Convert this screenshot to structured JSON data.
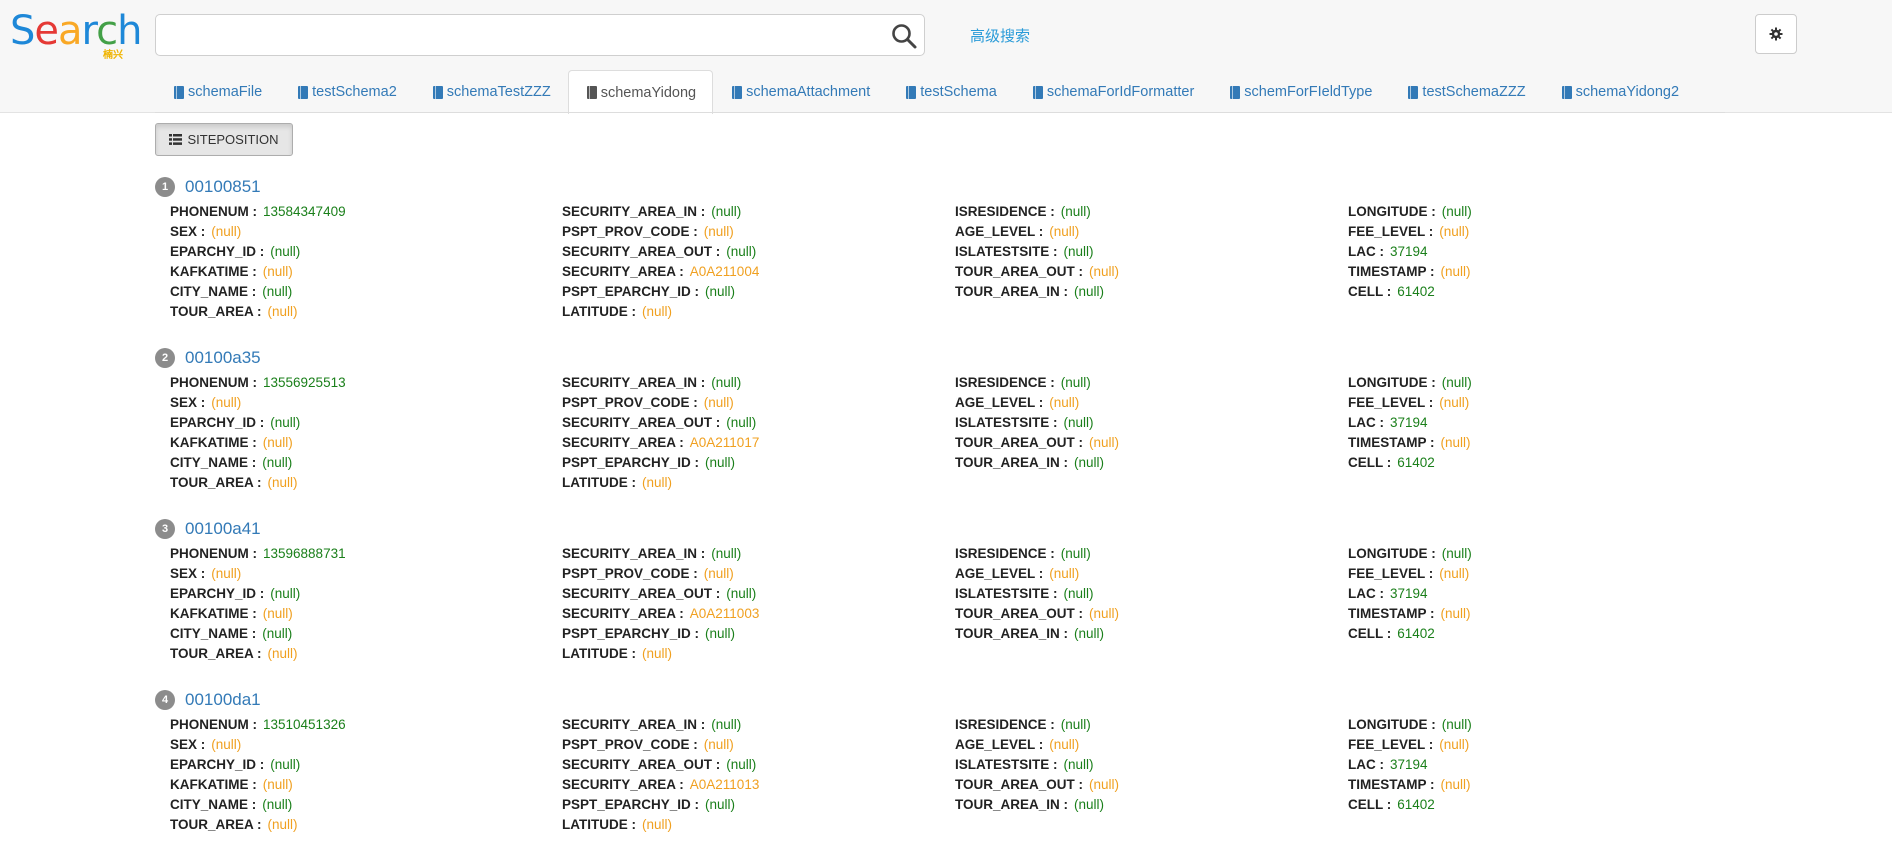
{
  "header": {
    "logo_main": "Search",
    "logo_sub": "楠兴",
    "search_value": "",
    "search_placeholder": "",
    "advanced_search": "高级搜索",
    "icons": {
      "search": "magnifier-icon",
      "settings": "gear-icon"
    }
  },
  "tabs": [
    {
      "label": "schemaFile",
      "active": false
    },
    {
      "label": "testSchema2",
      "active": false
    },
    {
      "label": "schemaTestZZZ",
      "active": false
    },
    {
      "label": "schemaYidong",
      "active": true
    },
    {
      "label": "schemaAttachment",
      "active": false
    },
    {
      "label": "testSchema",
      "active": false
    },
    {
      "label": "schemaForIdFormatter",
      "active": false
    },
    {
      "label": "schemForFIeldType",
      "active": false
    },
    {
      "label": "testSchemaZZZ",
      "active": false
    },
    {
      "label": "schemaYidong2",
      "active": false
    }
  ],
  "toolbar": {
    "siteposition_label": "SITEPOSITION"
  },
  "colors": {
    "link": "#337ab7",
    "value_green": "#1a7f1a",
    "value_orange": "#f0a020",
    "badge": "#8c8c8c"
  },
  "records": [
    {
      "index": "1",
      "id": "00100851",
      "fields": [
        [
          [
            "PHONENUM :",
            "13584347409",
            "g"
          ],
          [
            "SEX :",
            "(null)",
            "o"
          ],
          [
            "EPARCHY_ID :",
            "(null)",
            "g"
          ],
          [
            "KAFKATIME :",
            "(null)",
            "o"
          ],
          [
            "CITY_NAME :",
            "(null)",
            "g"
          ],
          [
            "TOUR_AREA :",
            "(null)",
            "o"
          ]
        ],
        [
          [
            "SECURITY_AREA_IN :",
            "(null)",
            "g"
          ],
          [
            "PSPT_PROV_CODE :",
            "(null)",
            "o"
          ],
          [
            "SECURITY_AREA_OUT :",
            "(null)",
            "g"
          ],
          [
            "SECURITY_AREA :",
            "A0A211004",
            "o"
          ],
          [
            "PSPT_EPARCHY_ID :",
            "(null)",
            "g"
          ],
          [
            "LATITUDE :",
            "(null)",
            "o"
          ]
        ],
        [
          [
            "ISRESIDENCE :",
            "(null)",
            "g"
          ],
          [
            "AGE_LEVEL :",
            "(null)",
            "o"
          ],
          [
            "ISLATESTSITE :",
            "(null)",
            "g"
          ],
          [
            "TOUR_AREA_OUT :",
            "(null)",
            "o"
          ],
          [
            "TOUR_AREA_IN :",
            "(null)",
            "g"
          ]
        ],
        [
          [
            "LONGITUDE :",
            "(null)",
            "g"
          ],
          [
            "FEE_LEVEL :",
            "(null)",
            "o"
          ],
          [
            "LAC :",
            "37194",
            "g"
          ],
          [
            "TIMESTAMP :",
            "(null)",
            "o"
          ],
          [
            "CELL :",
            "61402",
            "g"
          ]
        ]
      ]
    },
    {
      "index": "2",
      "id": "00100a35",
      "fields": [
        [
          [
            "PHONENUM :",
            "13556925513",
            "g"
          ],
          [
            "SEX :",
            "(null)",
            "o"
          ],
          [
            "EPARCHY_ID :",
            "(null)",
            "g"
          ],
          [
            "KAFKATIME :",
            "(null)",
            "o"
          ],
          [
            "CITY_NAME :",
            "(null)",
            "g"
          ],
          [
            "TOUR_AREA :",
            "(null)",
            "o"
          ]
        ],
        [
          [
            "SECURITY_AREA_IN :",
            "(null)",
            "g"
          ],
          [
            "PSPT_PROV_CODE :",
            "(null)",
            "o"
          ],
          [
            "SECURITY_AREA_OUT :",
            "(null)",
            "g"
          ],
          [
            "SECURITY_AREA :",
            "A0A211017",
            "o"
          ],
          [
            "PSPT_EPARCHY_ID :",
            "(null)",
            "g"
          ],
          [
            "LATITUDE :",
            "(null)",
            "o"
          ]
        ],
        [
          [
            "ISRESIDENCE :",
            "(null)",
            "g"
          ],
          [
            "AGE_LEVEL :",
            "(null)",
            "o"
          ],
          [
            "ISLATESTSITE :",
            "(null)",
            "g"
          ],
          [
            "TOUR_AREA_OUT :",
            "(null)",
            "o"
          ],
          [
            "TOUR_AREA_IN :",
            "(null)",
            "g"
          ]
        ],
        [
          [
            "LONGITUDE :",
            "(null)",
            "g"
          ],
          [
            "FEE_LEVEL :",
            "(null)",
            "o"
          ],
          [
            "LAC :",
            "37194",
            "g"
          ],
          [
            "TIMESTAMP :",
            "(null)",
            "o"
          ],
          [
            "CELL :",
            "61402",
            "g"
          ]
        ]
      ]
    },
    {
      "index": "3",
      "id": "00100a41",
      "fields": [
        [
          [
            "PHONENUM :",
            "13596888731",
            "g"
          ],
          [
            "SEX :",
            "(null)",
            "o"
          ],
          [
            "EPARCHY_ID :",
            "(null)",
            "g"
          ],
          [
            "KAFKATIME :",
            "(null)",
            "o"
          ],
          [
            "CITY_NAME :",
            "(null)",
            "g"
          ],
          [
            "TOUR_AREA :",
            "(null)",
            "o"
          ]
        ],
        [
          [
            "SECURITY_AREA_IN :",
            "(null)",
            "g"
          ],
          [
            "PSPT_PROV_CODE :",
            "(null)",
            "o"
          ],
          [
            "SECURITY_AREA_OUT :",
            "(null)",
            "g"
          ],
          [
            "SECURITY_AREA :",
            "A0A211003",
            "o"
          ],
          [
            "PSPT_EPARCHY_ID :",
            "(null)",
            "g"
          ],
          [
            "LATITUDE :",
            "(null)",
            "o"
          ]
        ],
        [
          [
            "ISRESIDENCE :",
            "(null)",
            "g"
          ],
          [
            "AGE_LEVEL :",
            "(null)",
            "o"
          ],
          [
            "ISLATESTSITE :",
            "(null)",
            "g"
          ],
          [
            "TOUR_AREA_OUT :",
            "(null)",
            "o"
          ],
          [
            "TOUR_AREA_IN :",
            "(null)",
            "g"
          ]
        ],
        [
          [
            "LONGITUDE :",
            "(null)",
            "g"
          ],
          [
            "FEE_LEVEL :",
            "(null)",
            "o"
          ],
          [
            "LAC :",
            "37194",
            "g"
          ],
          [
            "TIMESTAMP :",
            "(null)",
            "o"
          ],
          [
            "CELL :",
            "61402",
            "g"
          ]
        ]
      ]
    },
    {
      "index": "4",
      "id": "00100da1",
      "fields": [
        [
          [
            "PHONENUM :",
            "13510451326",
            "g"
          ],
          [
            "SEX :",
            "(null)",
            "o"
          ],
          [
            "EPARCHY_ID :",
            "(null)",
            "g"
          ],
          [
            "KAFKATIME :",
            "(null)",
            "o"
          ],
          [
            "CITY_NAME :",
            "(null)",
            "g"
          ],
          [
            "TOUR_AREA :",
            "(null)",
            "o"
          ]
        ],
        [
          [
            "SECURITY_AREA_IN :",
            "(null)",
            "g"
          ],
          [
            "PSPT_PROV_CODE :",
            "(null)",
            "o"
          ],
          [
            "SECURITY_AREA_OUT :",
            "(null)",
            "g"
          ],
          [
            "SECURITY_AREA :",
            "A0A211013",
            "o"
          ],
          [
            "PSPT_EPARCHY_ID :",
            "(null)",
            "g"
          ],
          [
            "LATITUDE :",
            "(null)",
            "o"
          ]
        ],
        [
          [
            "ISRESIDENCE :",
            "(null)",
            "g"
          ],
          [
            "AGE_LEVEL :",
            "(null)",
            "o"
          ],
          [
            "ISLATESTSITE :",
            "(null)",
            "g"
          ],
          [
            "TOUR_AREA_OUT :",
            "(null)",
            "o"
          ],
          [
            "TOUR_AREA_IN :",
            "(null)",
            "g"
          ]
        ],
        [
          [
            "LONGITUDE :",
            "(null)",
            "g"
          ],
          [
            "FEE_LEVEL :",
            "(null)",
            "o"
          ],
          [
            "LAC :",
            "37194",
            "g"
          ],
          [
            "TIMESTAMP :",
            "(null)",
            "o"
          ],
          [
            "CELL :",
            "61402",
            "g"
          ]
        ]
      ]
    }
  ]
}
